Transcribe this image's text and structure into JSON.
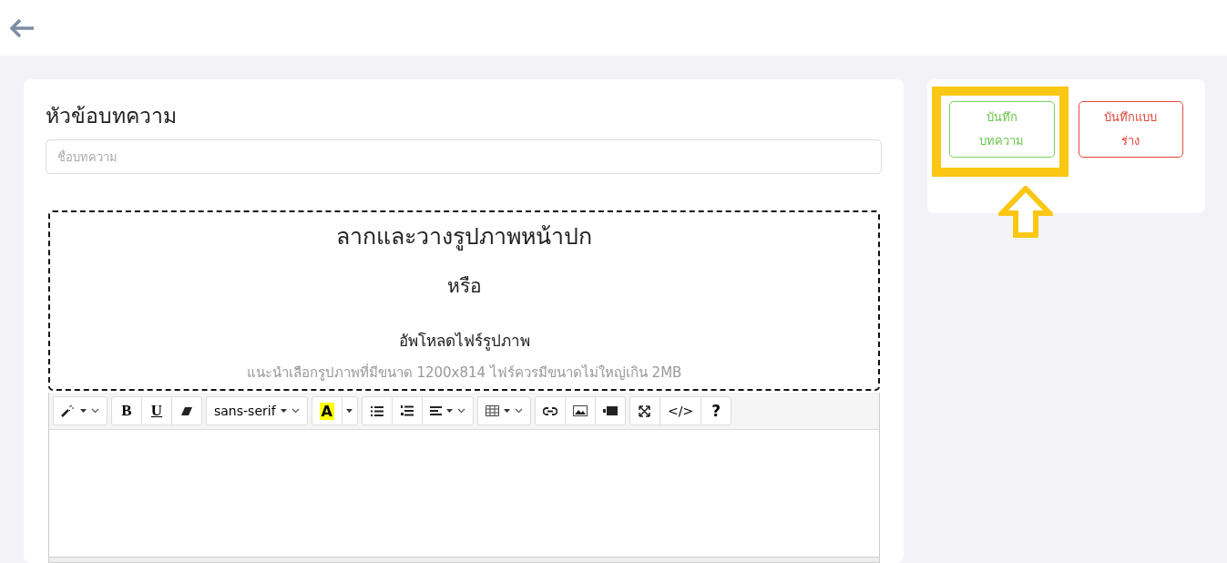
{
  "title_label": "หัวข้อบทความ",
  "title_field": {
    "placeholder": "ชื่อบทความ"
  },
  "cover_upload": {
    "heading": "ลากและวางรูปภาพหน้าปก",
    "or": "หรือ",
    "upload": "อัพโหลดไฟร์รูปภาพ",
    "hint": "แนะนำเลือกรูปภาพที่มีขนาด 1200x814 ไฟร์ควรมีขนาดไม่ใหญ่เกิน 2MB"
  },
  "toolbar": [
    [
      {
        "kind": "wand"
      }
    ],
    [
      {
        "kind": "bold",
        "label": "B"
      },
      {
        "kind": "underline",
        "label": "U"
      },
      {
        "kind": "eraser"
      }
    ],
    [
      {
        "kind": "font",
        "label": "sans-serif"
      }
    ],
    [
      {
        "kind": "color",
        "label": "A"
      },
      {
        "kind": "caret"
      }
    ],
    [
      {
        "kind": "bullets"
      },
      {
        "kind": "numbers"
      },
      {
        "kind": "align"
      }
    ],
    [
      {
        "kind": "table"
      }
    ],
    [
      {
        "kind": "link"
      },
      {
        "kind": "picture"
      },
      {
        "kind": "video"
      }
    ],
    [
      {
        "kind": "expand"
      },
      {
        "kind": "code",
        "label": "</>"
      },
      {
        "kind": "help",
        "label": "?"
      }
    ]
  ],
  "actions": [
    {
      "label_lines": [
        "บันทึก",
        "บทความ"
      ],
      "kind": "save",
      "highlighted": true
    },
    {
      "label_lines": [
        "บันทึกแบบ",
        "ร่าง"
      ],
      "kind": "draft",
      "highlighted": false
    }
  ]
}
